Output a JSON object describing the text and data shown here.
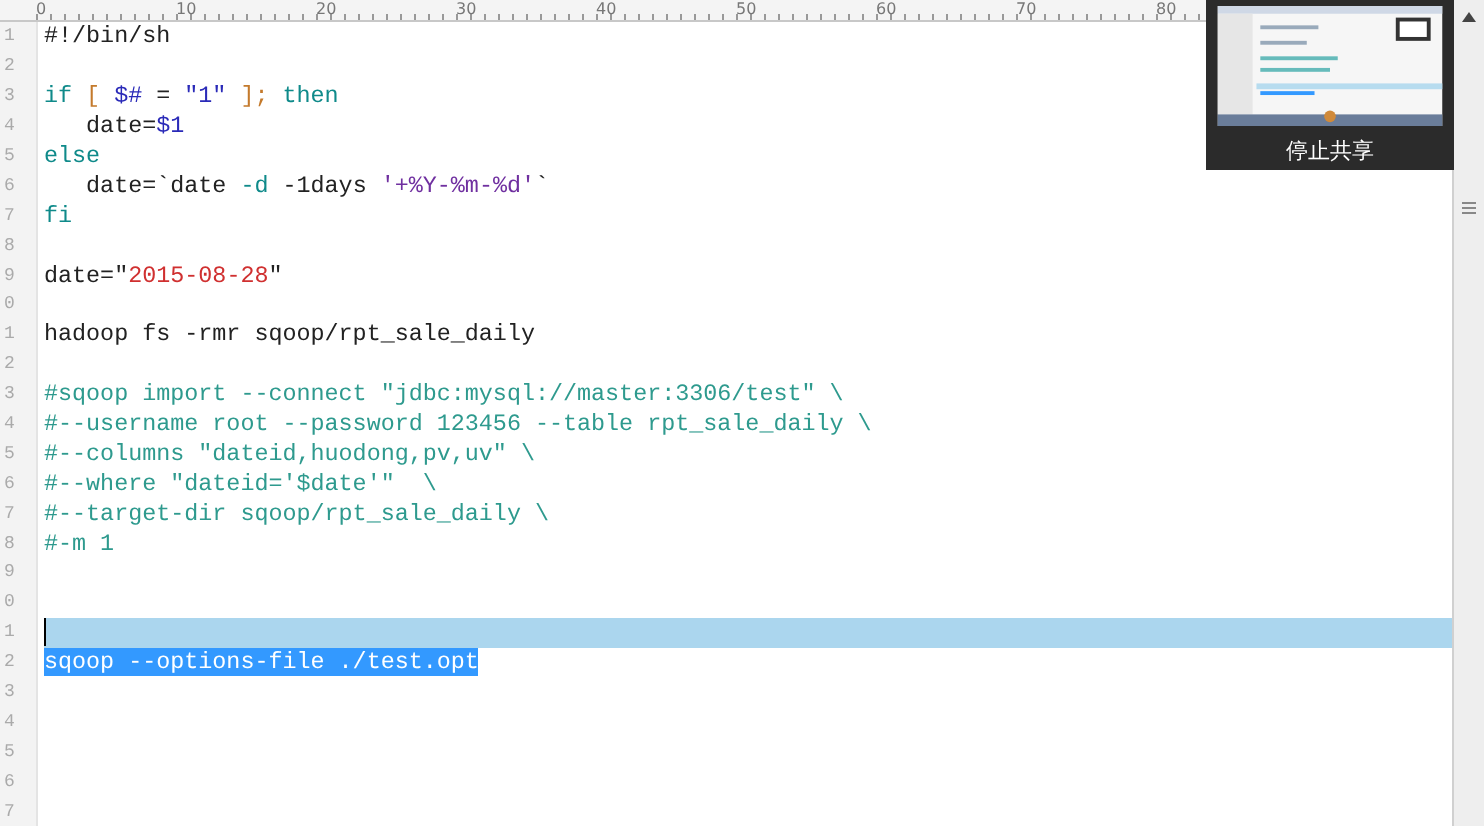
{
  "ruler": {
    "labels": [
      "0",
      "10",
      "20",
      "30",
      "40",
      "50",
      "60",
      "70",
      "80"
    ]
  },
  "lines": [
    {
      "number": "1",
      "current": false,
      "selected": false,
      "tokens": [
        {
          "text": "#!/bin/sh",
          "kind": "plain"
        }
      ]
    },
    {
      "number": "2",
      "current": false,
      "selected": false
    },
    {
      "number": "3",
      "current": false,
      "selected": false,
      "tokens": [
        {
          "text": "if",
          "kind": "keyword"
        },
        {
          "text": " [ ",
          "kind": "bracket"
        },
        {
          "text": "$#",
          "kind": "variable"
        },
        {
          "text": " = ",
          "kind": "plain"
        },
        {
          "text": "\"1\"",
          "kind": "variable"
        },
        {
          "text": " ];",
          "kind": "bracket"
        },
        {
          "text": " then",
          "kind": "keyword"
        }
      ]
    },
    {
      "number": "4",
      "current": false,
      "selected": false,
      "tokens": [
        {
          "text": "   date=",
          "kind": "plain"
        },
        {
          "text": "$1",
          "kind": "variable"
        }
      ]
    },
    {
      "number": "5",
      "current": false,
      "selected": false,
      "tokens": [
        {
          "text": "else",
          "kind": "keyword"
        }
      ]
    },
    {
      "number": "6",
      "current": false,
      "selected": false,
      "tokens": [
        {
          "text": "   date=`date ",
          "kind": "plain"
        },
        {
          "text": "-d",
          "kind": "keyword"
        },
        {
          "text": " -1days ",
          "kind": "plain"
        },
        {
          "text": "'+%Y-%m-%d'",
          "kind": "string"
        },
        {
          "text": "`",
          "kind": "plain"
        }
      ]
    },
    {
      "number": "7",
      "current": false,
      "selected": false,
      "tokens": [
        {
          "text": "fi",
          "kind": "keyword"
        }
      ]
    },
    {
      "number": "8",
      "current": false,
      "selected": false
    },
    {
      "number": "9",
      "current": false,
      "selected": false,
      "tokens": [
        {
          "text": "date=\"",
          "kind": "plain"
        },
        {
          "text": "2015-08-28",
          "kind": "date"
        },
        {
          "text": "\"",
          "kind": "plain"
        }
      ]
    },
    {
      "number": "0",
      "current": false,
      "selected": false
    },
    {
      "number": "1",
      "current": false,
      "selected": false,
      "tokens": [
        {
          "text": "hadoop fs -rmr sqoop/rpt_sale_daily",
          "kind": "plain"
        }
      ]
    },
    {
      "number": "2",
      "current": false,
      "selected": false
    },
    {
      "number": "3",
      "current": false,
      "selected": false,
      "tokens": [
        {
          "text": "#sqoop import --connect \"jdbc:mysql://master:3306/test\" \\",
          "kind": "comment"
        }
      ]
    },
    {
      "number": "4",
      "current": false,
      "selected": false,
      "tokens": [
        {
          "text": "#--username root --password 123456 --table rpt_sale_daily \\",
          "kind": "comment"
        }
      ]
    },
    {
      "number": "5",
      "current": false,
      "selected": false,
      "tokens": [
        {
          "text": "#--columns \"dateid,huodong,pv,uv\" \\",
          "kind": "comment"
        }
      ]
    },
    {
      "number": "6",
      "current": false,
      "selected": false,
      "tokens": [
        {
          "text": "#--where \"dateid='$date'\"  \\",
          "kind": "comment"
        }
      ]
    },
    {
      "number": "7",
      "current": false,
      "selected": false,
      "tokens": [
        {
          "text": "#--target-dir sqoop/rpt_sale_daily \\",
          "kind": "comment"
        }
      ]
    },
    {
      "number": "8",
      "current": false,
      "selected": false,
      "tokens": [
        {
          "text": "#-m 1",
          "kind": "comment"
        }
      ]
    },
    {
      "number": "9",
      "current": false,
      "selected": false
    },
    {
      "number": "0",
      "current": false,
      "selected": false
    },
    {
      "number": "1",
      "current": true,
      "selected": false
    },
    {
      "number": "2",
      "current": false,
      "selected": true,
      "tokens": [
        {
          "text": "sqoop --options-file ./test.opt",
          "kind": "plain"
        }
      ]
    },
    {
      "number": "3",
      "current": false,
      "selected": false
    },
    {
      "number": "4",
      "current": false,
      "selected": false
    },
    {
      "number": "5",
      "current": false,
      "selected": false
    },
    {
      "number": "6",
      "current": false,
      "selected": false
    },
    {
      "number": "7",
      "current": false,
      "selected": false
    }
  ],
  "share_panel": {
    "kind": "picture",
    "button": "停止共享"
  }
}
